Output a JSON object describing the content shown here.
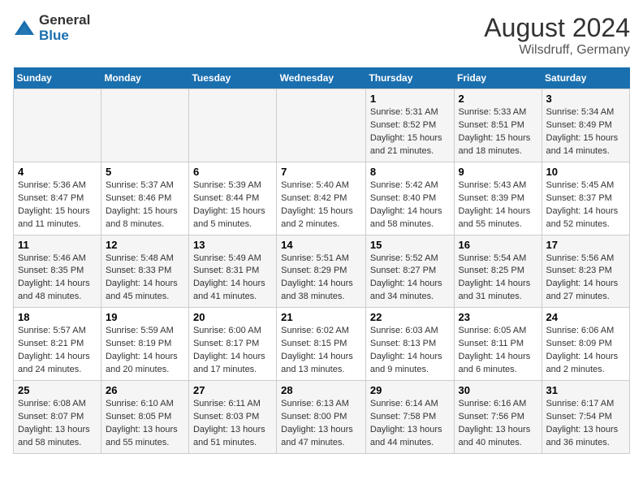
{
  "logo": {
    "general": "General",
    "blue": "Blue"
  },
  "title": "August 2024",
  "subtitle": "Wilsdruff, Germany",
  "days_header": [
    "Sunday",
    "Monday",
    "Tuesday",
    "Wednesday",
    "Thursday",
    "Friday",
    "Saturday"
  ],
  "weeks": [
    [
      {
        "day": "",
        "info": ""
      },
      {
        "day": "",
        "info": ""
      },
      {
        "day": "",
        "info": ""
      },
      {
        "day": "",
        "info": ""
      },
      {
        "day": "1",
        "info": "Sunrise: 5:31 AM\nSunset: 8:52 PM\nDaylight: 15 hours and 21 minutes."
      },
      {
        "day": "2",
        "info": "Sunrise: 5:33 AM\nSunset: 8:51 PM\nDaylight: 15 hours and 18 minutes."
      },
      {
        "day": "3",
        "info": "Sunrise: 5:34 AM\nSunset: 8:49 PM\nDaylight: 15 hours and 14 minutes."
      }
    ],
    [
      {
        "day": "4",
        "info": "Sunrise: 5:36 AM\nSunset: 8:47 PM\nDaylight: 15 hours and 11 minutes."
      },
      {
        "day": "5",
        "info": "Sunrise: 5:37 AM\nSunset: 8:46 PM\nDaylight: 15 hours and 8 minutes."
      },
      {
        "day": "6",
        "info": "Sunrise: 5:39 AM\nSunset: 8:44 PM\nDaylight: 15 hours and 5 minutes."
      },
      {
        "day": "7",
        "info": "Sunrise: 5:40 AM\nSunset: 8:42 PM\nDaylight: 15 hours and 2 minutes."
      },
      {
        "day": "8",
        "info": "Sunrise: 5:42 AM\nSunset: 8:40 PM\nDaylight: 14 hours and 58 minutes."
      },
      {
        "day": "9",
        "info": "Sunrise: 5:43 AM\nSunset: 8:39 PM\nDaylight: 14 hours and 55 minutes."
      },
      {
        "day": "10",
        "info": "Sunrise: 5:45 AM\nSunset: 8:37 PM\nDaylight: 14 hours and 52 minutes."
      }
    ],
    [
      {
        "day": "11",
        "info": "Sunrise: 5:46 AM\nSunset: 8:35 PM\nDaylight: 14 hours and 48 minutes."
      },
      {
        "day": "12",
        "info": "Sunrise: 5:48 AM\nSunset: 8:33 PM\nDaylight: 14 hours and 45 minutes."
      },
      {
        "day": "13",
        "info": "Sunrise: 5:49 AM\nSunset: 8:31 PM\nDaylight: 14 hours and 41 minutes."
      },
      {
        "day": "14",
        "info": "Sunrise: 5:51 AM\nSunset: 8:29 PM\nDaylight: 14 hours and 38 minutes."
      },
      {
        "day": "15",
        "info": "Sunrise: 5:52 AM\nSunset: 8:27 PM\nDaylight: 14 hours and 34 minutes."
      },
      {
        "day": "16",
        "info": "Sunrise: 5:54 AM\nSunset: 8:25 PM\nDaylight: 14 hours and 31 minutes."
      },
      {
        "day": "17",
        "info": "Sunrise: 5:56 AM\nSunset: 8:23 PM\nDaylight: 14 hours and 27 minutes."
      }
    ],
    [
      {
        "day": "18",
        "info": "Sunrise: 5:57 AM\nSunset: 8:21 PM\nDaylight: 14 hours and 24 minutes."
      },
      {
        "day": "19",
        "info": "Sunrise: 5:59 AM\nSunset: 8:19 PM\nDaylight: 14 hours and 20 minutes."
      },
      {
        "day": "20",
        "info": "Sunrise: 6:00 AM\nSunset: 8:17 PM\nDaylight: 14 hours and 17 minutes."
      },
      {
        "day": "21",
        "info": "Sunrise: 6:02 AM\nSunset: 8:15 PM\nDaylight: 14 hours and 13 minutes."
      },
      {
        "day": "22",
        "info": "Sunrise: 6:03 AM\nSunset: 8:13 PM\nDaylight: 14 hours and 9 minutes."
      },
      {
        "day": "23",
        "info": "Sunrise: 6:05 AM\nSunset: 8:11 PM\nDaylight: 14 hours and 6 minutes."
      },
      {
        "day": "24",
        "info": "Sunrise: 6:06 AM\nSunset: 8:09 PM\nDaylight: 14 hours and 2 minutes."
      }
    ],
    [
      {
        "day": "25",
        "info": "Sunrise: 6:08 AM\nSunset: 8:07 PM\nDaylight: 13 hours and 58 minutes."
      },
      {
        "day": "26",
        "info": "Sunrise: 6:10 AM\nSunset: 8:05 PM\nDaylight: 13 hours and 55 minutes."
      },
      {
        "day": "27",
        "info": "Sunrise: 6:11 AM\nSunset: 8:03 PM\nDaylight: 13 hours and 51 minutes."
      },
      {
        "day": "28",
        "info": "Sunrise: 6:13 AM\nSunset: 8:00 PM\nDaylight: 13 hours and 47 minutes."
      },
      {
        "day": "29",
        "info": "Sunrise: 6:14 AM\nSunset: 7:58 PM\nDaylight: 13 hours and 44 minutes."
      },
      {
        "day": "30",
        "info": "Sunrise: 6:16 AM\nSunset: 7:56 PM\nDaylight: 13 hours and 40 minutes."
      },
      {
        "day": "31",
        "info": "Sunrise: 6:17 AM\nSunset: 7:54 PM\nDaylight: 13 hours and 36 minutes."
      }
    ]
  ]
}
